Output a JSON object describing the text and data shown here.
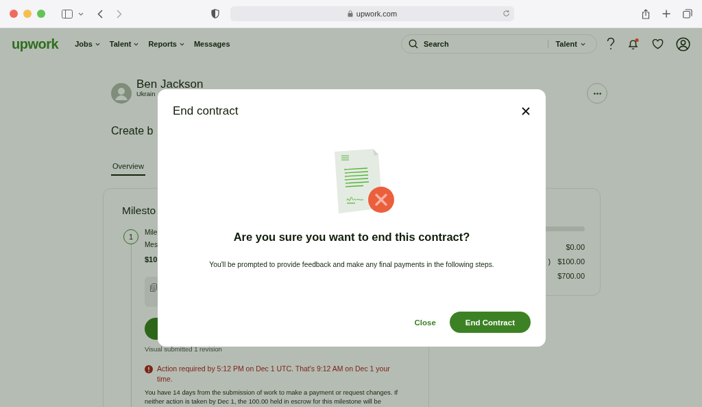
{
  "browser": {
    "url": "upwork.com"
  },
  "nav": {
    "logo": "upwork",
    "menu": [
      {
        "label": "Jobs",
        "dropdown": true
      },
      {
        "label": "Talent",
        "dropdown": true
      },
      {
        "label": "Reports",
        "dropdown": true
      },
      {
        "label": "Messages",
        "dropdown": false
      }
    ],
    "search": {
      "placeholder": "Search",
      "scope": "Talent"
    },
    "notifications_unread": true
  },
  "contract": {
    "name": "Ben Jackson",
    "location": "Ukrain",
    "title": "Create b",
    "tabs": [
      {
        "label": "Overview",
        "selected": true
      }
    ]
  },
  "milestones": {
    "heading": "Milesto",
    "items": [
      {
        "number": "1",
        "title": "Mile",
        "subtitle": "Mes",
        "amount": "$10"
      }
    ],
    "note": "Visual submitted 1 revision",
    "alert": "Action required by 5:12 PM on Dec 1 UTC. That's 9:12 AM on Dec 1 your time.",
    "info_lines": [
      "You have 14 days from the submission of work to make a payment or request changes. If",
      "neither action is taken by Dec 1, the 100.00 held in escrow for this milestone will be"
    ]
  },
  "summary": {
    "rows": [
      {
        "label": "",
        "amount": "$0.00"
      },
      {
        "label": ")",
        "amount": "$100.00"
      },
      {
        "label": "",
        "amount": "$700.00"
      }
    ]
  },
  "modal": {
    "title": "End contract",
    "question": "Are you sure you want to end this contract?",
    "message": "You'll be prompted to provide feedback and make any final payments in the following steps.",
    "buttons": [
      {
        "label": "Close",
        "kind": "text"
      },
      {
        "label": "End Contract",
        "kind": "primary"
      }
    ]
  }
}
